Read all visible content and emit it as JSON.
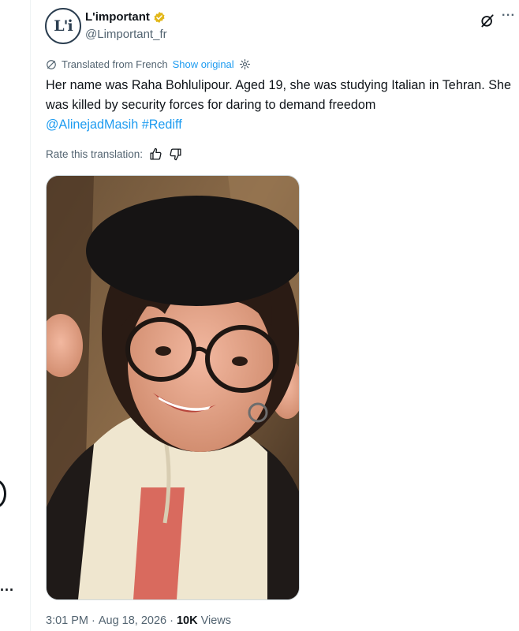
{
  "account": {
    "display_name": "L'important",
    "handle": "@Limportant_fr",
    "avatar_text": "L'i"
  },
  "translation": {
    "label": "Translated from French",
    "show_original": "Show original",
    "rate_label": "Rate this translation:"
  },
  "tweet": {
    "text": "Her name was Raha Bohlulipour. Aged 19, she was studying Italian in Tehran. She was killed by security forces for daring to demand freedom",
    "mention": "@AlinejadMasih",
    "hashtag": "#Rediff"
  },
  "meta": {
    "time": "3:01 PM",
    "date": "Aug 18, 2026",
    "views_count": "10K",
    "views_label": "Views",
    "separator": "·"
  },
  "left_rail": {
    "dots": "..."
  },
  "colors": {
    "accent": "#1d9bf0",
    "text": "#0f1419",
    "muted": "#536471",
    "verified_gold": "#e2b719"
  }
}
